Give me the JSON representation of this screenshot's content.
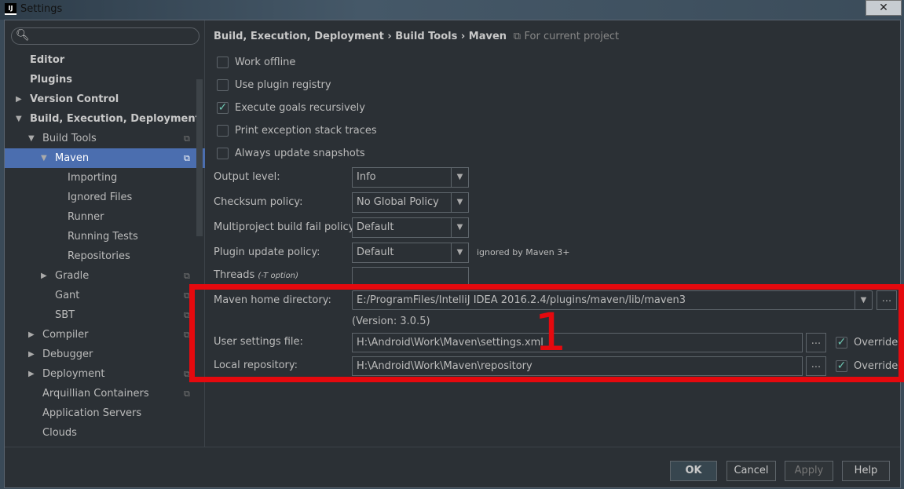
{
  "window": {
    "title": "Settings",
    "app_icon": "IJ",
    "close": "✕"
  },
  "sidebar": {
    "search_placeholder": "",
    "items": [
      {
        "label": "Editor",
        "level": 0,
        "bold": true,
        "arrow": ""
      },
      {
        "label": "Plugins",
        "level": 0,
        "bold": true,
        "arrow": ""
      },
      {
        "label": "Version Control",
        "level": 0,
        "bold": true,
        "arrow": "▶"
      },
      {
        "label": "Build, Execution, Deployment",
        "level": 0,
        "bold": true,
        "arrow": "▼"
      },
      {
        "label": "Build Tools",
        "level": 1,
        "arrow": "▼",
        "copy": true
      },
      {
        "label": "Maven",
        "level": 2,
        "arrow": "▼",
        "copy": true,
        "selected": true
      },
      {
        "label": "Importing",
        "level": 3
      },
      {
        "label": "Ignored Files",
        "level": 3
      },
      {
        "label": "Runner",
        "level": 3
      },
      {
        "label": "Running Tests",
        "level": 3
      },
      {
        "label": "Repositories",
        "level": 3
      },
      {
        "label": "Gradle",
        "level": 2,
        "arrow": "▶",
        "copy": true
      },
      {
        "label": "Gant",
        "level": 2,
        "copy": true
      },
      {
        "label": "SBT",
        "level": 2,
        "copy": true
      },
      {
        "label": "Compiler",
        "level": 1,
        "arrow": "▶",
        "copy": true
      },
      {
        "label": "Debugger",
        "level": 1,
        "arrow": "▶"
      },
      {
        "label": "Deployment",
        "level": 1,
        "arrow": "▶",
        "copy": true
      },
      {
        "label": "Arquillian Containers",
        "level": 1,
        "copy": true
      },
      {
        "label": "Application Servers",
        "level": 1
      },
      {
        "label": "Clouds",
        "level": 1
      }
    ]
  },
  "breadcrumb": {
    "p1": "Build, Execution, Deployment",
    "p2": "Build Tools",
    "p3": "Maven",
    "sep": "›",
    "for_project": "For current project"
  },
  "checkboxes": [
    {
      "label": "Work offline",
      "checked": false
    },
    {
      "label": "Use plugin registry",
      "checked": false
    },
    {
      "label": "Execute goals recursively",
      "checked": true
    },
    {
      "label": "Print exception stack traces",
      "checked": false
    },
    {
      "label": "Always update snapshots",
      "checked": false
    }
  ],
  "selects": [
    {
      "label": "Output level:",
      "value": "Info"
    },
    {
      "label": "Checksum policy:",
      "value": "No Global Policy"
    },
    {
      "label": "Multiproject build fail policy:",
      "value": "Default"
    },
    {
      "label": "Plugin update policy:",
      "value": "Default",
      "note": "ignored by Maven 3+"
    }
  ],
  "threads": {
    "label": "Threads",
    "hint": "(-T option)",
    "value": ""
  },
  "maven_home": {
    "label": "Maven home directory:",
    "value": "E:/ProgramFiles/IntelliJ IDEA 2016.2.4/plugins/maven/lib/maven3",
    "version": "(Version: 3.0.5)"
  },
  "user_settings": {
    "label": "User settings file:",
    "value": "H:\\Android\\Work\\Maven\\settings.xml",
    "override": "Override",
    "checked": true
  },
  "local_repo": {
    "label": "Local repository:",
    "value": "H:\\Android\\Work\\Maven\\repository",
    "override": "Override",
    "checked": true
  },
  "annotation": {
    "number": "1",
    "color": "#e5090e"
  },
  "buttons": {
    "ok": "OK",
    "cancel": "Cancel",
    "apply": "Apply",
    "help": "Help",
    "browse": "..."
  },
  "colors": {
    "selection": "#4b6eaf",
    "background": "#2b3035",
    "check": "#6ec6b2"
  }
}
